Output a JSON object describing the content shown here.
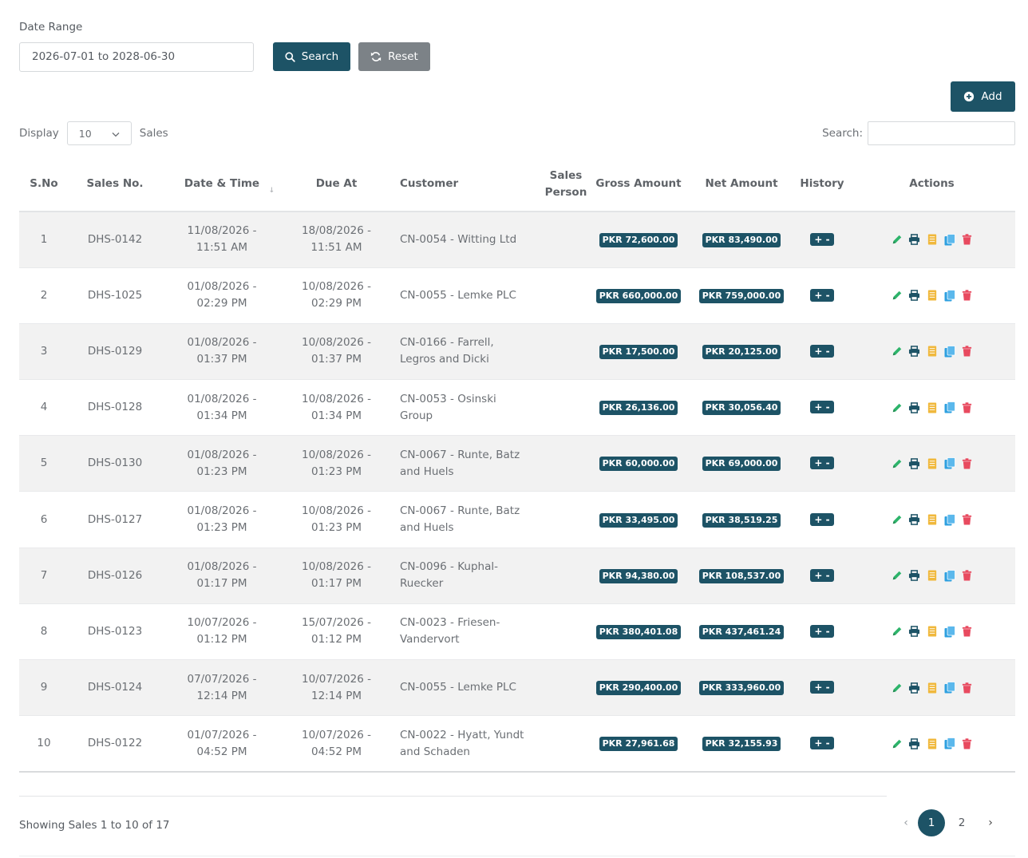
{
  "filter": {
    "label": "Date Range",
    "date_range": "2026-07-01 to 2028-06-30",
    "search_label": "Search",
    "reset_label": "Reset"
  },
  "add_label": "Add",
  "display": {
    "prefix": "Display",
    "value": "10",
    "suffix": "Sales"
  },
  "search": {
    "label": "Search:",
    "value": ""
  },
  "columns": {
    "sno": "S.No",
    "sales_no": "Sales No.",
    "date_time": "Date & Time",
    "due_at": "Due At",
    "customer": "Customer",
    "sales_person": "Sales Person",
    "gross": "Gross Amount",
    "net": "Net Amount",
    "history": "History",
    "actions": "Actions"
  },
  "history_label": "+ -",
  "colors": {
    "primary": "#1d5366",
    "reset": "#7c8287",
    "edit": "#2eb46b",
    "print": "#1d5366",
    "note": "#f0b83c",
    "copy": "#2ea0e0",
    "delete": "#e84a5f"
  },
  "rows": [
    {
      "sno": "1",
      "sales_no": "DHS-0142",
      "date": "11/08/2026 -",
      "time": "11:51 AM",
      "due_date": "18/08/2026 -",
      "due_time": "11:51 AM",
      "cust_l1": "CN-0054 - Witting Ltd",
      "cust_l2": "",
      "person": "",
      "gross": "PKR 72,600.00",
      "net": "PKR 83,490.00"
    },
    {
      "sno": "2",
      "sales_no": "DHS-1025",
      "date": "01/08/2026 -",
      "time": "02:29 PM",
      "due_date": "10/08/2026 -",
      "due_time": "02:29 PM",
      "cust_l1": "CN-0055 - Lemke PLC",
      "cust_l2": "",
      "person": "",
      "gross": "PKR 660,000.00",
      "net": "PKR 759,000.00"
    },
    {
      "sno": "3",
      "sales_no": "DHS-0129",
      "date": "01/08/2026 -",
      "time": "01:37 PM",
      "due_date": "10/08/2026 -",
      "due_time": "01:37 PM",
      "cust_l1": "CN-0166 - Farrell,",
      "cust_l2": "Legros and Dicki",
      "person": "",
      "gross": "PKR 17,500.00",
      "net": "PKR 20,125.00"
    },
    {
      "sno": "4",
      "sales_no": "DHS-0128",
      "date": "01/08/2026 -",
      "time": "01:34 PM",
      "due_date": "10/08/2026 -",
      "due_time": "01:34 PM",
      "cust_l1": "CN-0053 - Osinski",
      "cust_l2": "Group",
      "person": "",
      "gross": "PKR 26,136.00",
      "net": "PKR 30,056.40"
    },
    {
      "sno": "5",
      "sales_no": "DHS-0130",
      "date": "01/08/2026 -",
      "time": "01:23 PM",
      "due_date": "10/08/2026 -",
      "due_time": "01:23 PM",
      "cust_l1": "CN-0067 - Runte, Batz",
      "cust_l2": "and Huels",
      "person": "",
      "gross": "PKR 60,000.00",
      "net": "PKR 69,000.00"
    },
    {
      "sno": "6",
      "sales_no": "DHS-0127",
      "date": "01/08/2026 -",
      "time": "01:23 PM",
      "due_date": "10/08/2026 -",
      "due_time": "01:23 PM",
      "cust_l1": "CN-0067 - Runte, Batz",
      "cust_l2": "and Huels",
      "person": "",
      "gross": "PKR 33,495.00",
      "net": "PKR 38,519.25"
    },
    {
      "sno": "7",
      "sales_no": "DHS-0126",
      "date": "01/08/2026 -",
      "time": "01:17 PM",
      "due_date": "10/08/2026 -",
      "due_time": "01:17 PM",
      "cust_l1": "CN-0096 - Kuphal-",
      "cust_l2": "Ruecker",
      "person": "",
      "gross": "PKR 94,380.00",
      "net": "PKR 108,537.00"
    },
    {
      "sno": "8",
      "sales_no": "DHS-0123",
      "date": "10/07/2026 -",
      "time": "01:12 PM",
      "due_date": "15/07/2026 -",
      "due_time": "01:12 PM",
      "cust_l1": "CN-0023 - Friesen-",
      "cust_l2": "Vandervort",
      "person": "",
      "gross": "PKR 380,401.08",
      "net": "PKR 437,461.24"
    },
    {
      "sno": "9",
      "sales_no": "DHS-0124",
      "date": "07/07/2026 -",
      "time": "12:14 PM",
      "due_date": "10/07/2026 -",
      "due_time": "12:14 PM",
      "cust_l1": "CN-0055 - Lemke PLC",
      "cust_l2": "",
      "person": "",
      "gross": "PKR 290,400.00",
      "net": "PKR 333,960.00"
    },
    {
      "sno": "10",
      "sales_no": "DHS-0122",
      "date": "01/07/2026 -",
      "time": "04:52 PM",
      "due_date": "10/07/2026 -",
      "due_time": "04:52 PM",
      "cust_l1": "CN-0022 - Hyatt, Yundt",
      "cust_l2": "and Schaden",
      "person": "",
      "gross": "PKR 27,961.68",
      "net": "PKR 32,155.93"
    }
  ],
  "footer": {
    "info": "Showing Sales 1 to 10 of 17",
    "prev": "‹",
    "next": "›",
    "pages": [
      "1",
      "2"
    ],
    "current_page": "1"
  }
}
